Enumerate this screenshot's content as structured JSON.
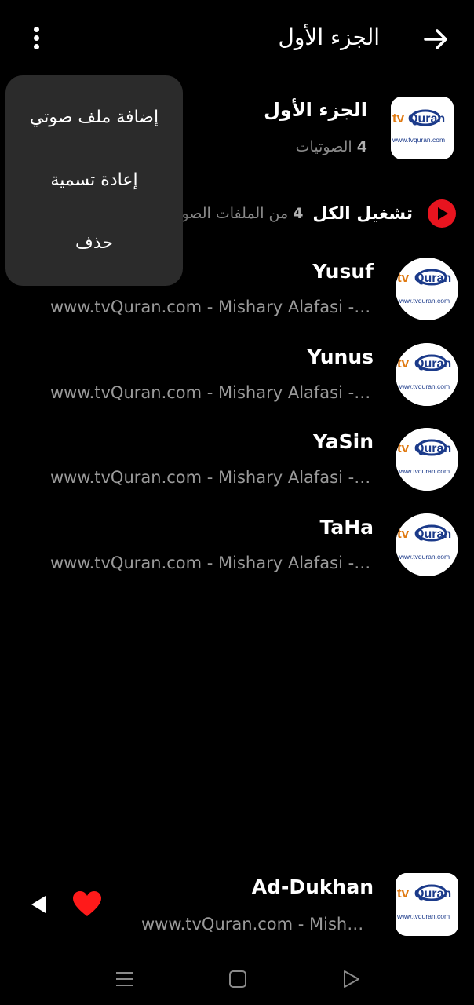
{
  "app_bar": {
    "title": "الجزء الأول",
    "back_icon": "arrow-right-icon",
    "more_icon": "more-vertical-icon"
  },
  "playlist": {
    "title": "الجزء الأول",
    "count": "4",
    "count_label": "الصوتيات",
    "thumbnail_logo": "tvQuran-logo"
  },
  "play_all": {
    "label": "تشغيل الكل",
    "count": "4",
    "count_text": "من الملفات الصوتية",
    "icon": "play-circle-icon",
    "accent_color": "#e8141f"
  },
  "tracks": [
    {
      "title": "Yusuf",
      "subtitle": "www.tvQuran.com - Mishary Alafasi - …"
    },
    {
      "title": "Yunus",
      "subtitle": "www.tvQuran.com - Mishary Alafasi - …"
    },
    {
      "title": "YaSin",
      "subtitle": "www.tvQuran.com - Mishary Alafasi - …"
    },
    {
      "title": "TaHa",
      "subtitle": "www.tvQuran.com - Mishary Alafasi - …"
    }
  ],
  "menu": {
    "items": [
      "إضافة ملف صوتي",
      "إعادة تسمية",
      "حذف"
    ]
  },
  "mini_player": {
    "title": "Ad-Dukhan",
    "subtitle": "www.tvQuran.com - Misha…",
    "play_icon": "play-icon",
    "favorite_icon": "heart-icon",
    "favorite_color": "#ff1a1a"
  },
  "system_nav": {
    "icons": [
      "recent-apps-icon",
      "home-icon",
      "back-icon"
    ]
  }
}
